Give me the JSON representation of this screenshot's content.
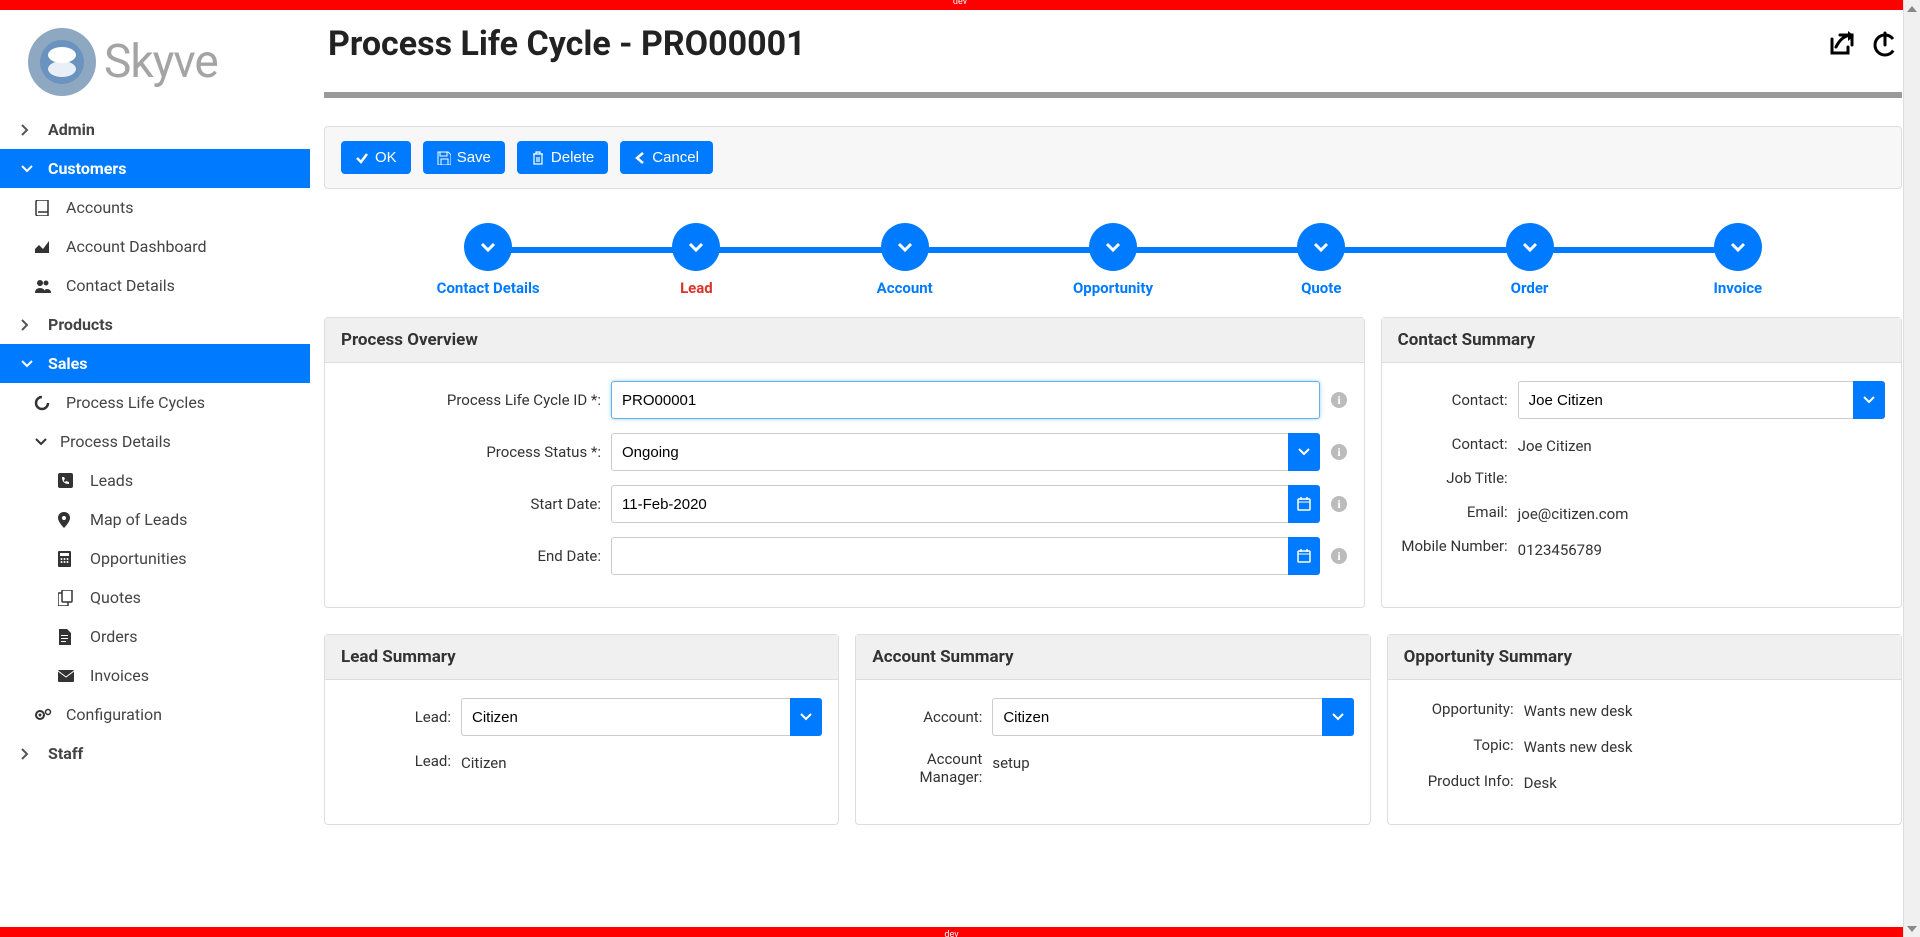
{
  "brand": "Skyve",
  "dev_tag": "dev",
  "page_title": "Process Life Cycle - PRO00001",
  "nav": {
    "admin": "Admin",
    "customers": "Customers",
    "accounts": "Accounts",
    "account_dashboard": "Account Dashboard",
    "contact_details": "Contact Details",
    "products": "Products",
    "sales": "Sales",
    "process_life_cycles": "Process Life Cycles",
    "process_details": "Process Details",
    "leads": "Leads",
    "map_of_leads": "Map of Leads",
    "opportunities": "Opportunities",
    "quotes": "Quotes",
    "orders": "Orders",
    "invoices": "Invoices",
    "configuration": "Configuration",
    "staff": "Staff"
  },
  "toolbar": {
    "ok": "OK",
    "save": "Save",
    "delete": "Delete",
    "cancel": "Cancel"
  },
  "steps": {
    "contact_details": "Contact Details",
    "lead": "Lead",
    "account": "Account",
    "opportunity": "Opportunity",
    "quote": "Quote",
    "order": "Order",
    "invoice": "Invoice"
  },
  "overview": {
    "heading": "Process Overview",
    "id_label": "Process Life Cycle ID *:",
    "id_value": "PRO00001",
    "status_label": "Process Status *:",
    "status_value": "Ongoing",
    "start_label": "Start Date:",
    "start_value": "11-Feb-2020",
    "end_label": "End Date:",
    "end_value": ""
  },
  "contact_summary": {
    "heading": "Contact Summary",
    "contact_label": "Contact:",
    "contact_value": "Joe Citizen",
    "contact2_label": "Contact:",
    "contact2_value": "Joe Citizen",
    "job_label": "Job Title:",
    "job_value": "",
    "email_label": "Email:",
    "email_value": "joe@citizen.com",
    "mobile_label": "Mobile Number:",
    "mobile_value": "0123456789"
  },
  "lead_summary": {
    "heading": "Lead Summary",
    "lead_label": "Lead:",
    "lead_value": "Citizen",
    "lead2_label": "Lead:",
    "lead2_value": "Citizen"
  },
  "account_summary": {
    "heading": "Account Summary",
    "account_label": "Account:",
    "account_value": "Citizen",
    "manager_label": "Account Manager:",
    "manager_value": "setup"
  },
  "opportunity_summary": {
    "heading": "Opportunity Summary",
    "opportunity_label": "Opportunity:",
    "opportunity_value": "Wants new desk",
    "topic_label": "Topic:",
    "topic_value": "Wants new desk",
    "product_label": "Product Info:",
    "product_value": "Desk"
  }
}
